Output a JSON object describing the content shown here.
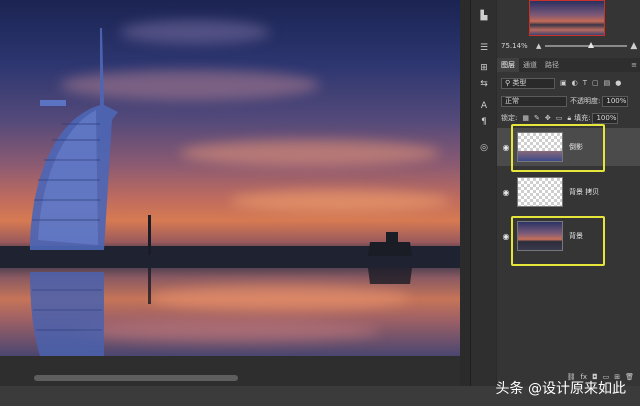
{
  "navigator": {
    "zoom": "75.14%"
  },
  "layers_panel": {
    "tabs": [
      {
        "label": "图层"
      },
      {
        "label": "通道"
      },
      {
        "label": "路径"
      }
    ],
    "filter_label": "类型",
    "blend_mode": "正常",
    "opacity_label": "不透明度:",
    "opacity_value": "100%",
    "lock_label": "锁定:",
    "fill_label": "填充:",
    "fill_value": "100%",
    "layers": [
      {
        "name": "倒影",
        "visible": true,
        "selected": true,
        "thumb": "mixed"
      },
      {
        "name": "背景 拷贝",
        "visible": true,
        "selected": false,
        "thumb": "transparent"
      },
      {
        "name": "背景",
        "visible": true,
        "selected": false,
        "thumb": "photo"
      }
    ]
  },
  "highlight_color": "#e6e53a",
  "watermark": "头条 @设计原来如此"
}
